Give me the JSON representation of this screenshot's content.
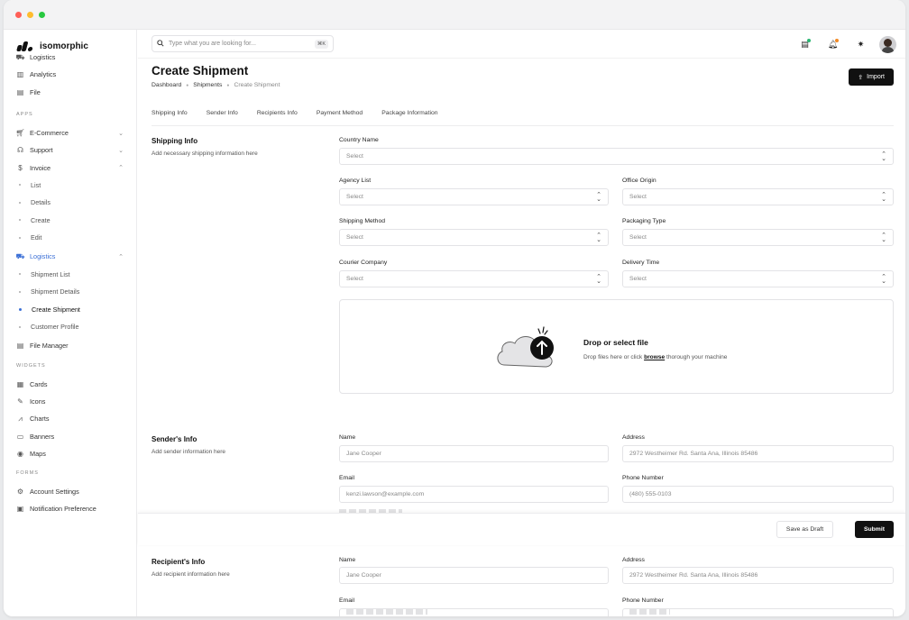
{
  "brand": {
    "name": "isomorphic"
  },
  "sidebar": {
    "top_items": [
      {
        "label": "Logistics",
        "icon": "truck-icon"
      },
      {
        "label": "Analytics",
        "icon": "analytics-icon"
      },
      {
        "label": "File",
        "icon": "file-icon"
      }
    ],
    "apps_label": "APPS",
    "apps": [
      {
        "label": "E-Commerce",
        "icon": "cart-icon"
      },
      {
        "label": "Support",
        "icon": "headset-icon"
      },
      {
        "label": "Invoice",
        "icon": "dollar-icon"
      }
    ],
    "invoice_sub": [
      "List",
      "Details",
      "Create",
      "Edit"
    ],
    "logistics": {
      "label": "Logistics",
      "icon": "truck-icon"
    },
    "logistics_sub": [
      "Shipment List",
      "Shipment Details",
      "Create Shipment",
      "Customer Profile"
    ],
    "file_manager": {
      "label": "File Manager",
      "icon": "folder-icon"
    },
    "widgets_label": "WIDGETS",
    "widgets": [
      {
        "label": "Cards",
        "icon": "cards-icon"
      },
      {
        "label": "Icons",
        "icon": "icons-icon"
      },
      {
        "label": "Charts",
        "icon": "chart-icon"
      },
      {
        "label": "Banners",
        "icon": "banner-icon"
      },
      {
        "label": "Maps",
        "icon": "map-pin-icon"
      }
    ],
    "forms_label": "FORMS",
    "forms": [
      {
        "label": "Account Settings",
        "icon": "user-settings-icon"
      },
      {
        "label": "Notification Preference",
        "icon": "notification-settings-icon"
      }
    ]
  },
  "search": {
    "placeholder": "Type what you are looking for...",
    "shortcut": "⌘K"
  },
  "header": {
    "title": "Create Shipment",
    "breadcrumb": [
      "Dashboard",
      "Shipments",
      "Create Shipment"
    ],
    "import_label": "Import"
  },
  "tabs": [
    "Shipping Info",
    "Sender Info",
    "Recipients Info",
    "Payment Method",
    "Package Information"
  ],
  "shipping": {
    "title": "Shipping Info",
    "desc": "Add necessary shipping information here",
    "country_label": "Country Name",
    "agency_label": "Agency List",
    "office_label": "Office Origin",
    "method_label": "Shipping Method",
    "packaging_label": "Packaging Type",
    "courier_label": "Courier Company",
    "delivery_label": "Delivery Time",
    "select_placeholder": "Select"
  },
  "dropzone": {
    "title": "Drop or select file",
    "desc_before": "Drop files here or click",
    "desc_link": "browse",
    "desc_after": "thorough your machine"
  },
  "sender": {
    "title": "Sender's Info",
    "desc": "Add sender information here",
    "name_label": "Name",
    "name_value": "Jane Cooper",
    "address_label": "Address",
    "address_value": "2972 Westheimer Rd. Santa Ana, Illinois 85486",
    "email_label": "Email",
    "email_value": "kenzi.lawson@example.com",
    "phone_label": "Phone Number",
    "phone_value": "(480) 555-0103"
  },
  "footer": {
    "draft_label": "Save as Draft",
    "submit_label": "Submit"
  },
  "recipient": {
    "title": "Recipient's Info",
    "desc": "Add recipient information here",
    "name_label": "Name",
    "name_value": "Jane Cooper",
    "address_label": "Address",
    "address_value": "2972 Westheimer Rd. Santa Ana, Illinois 85486",
    "email_label": "Email",
    "phone_label": "Phone Number"
  },
  "colors": {
    "accent": "#3b6fd6",
    "primary_button": "#111111"
  }
}
